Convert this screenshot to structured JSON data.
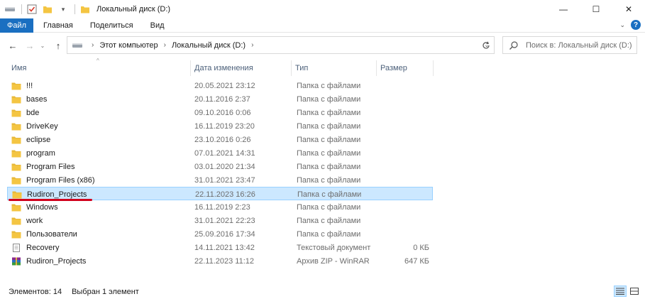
{
  "window": {
    "title": "Локальный диск (D:)",
    "controls": {
      "minimize": "—",
      "maximize": "☐",
      "close": "✕"
    }
  },
  "ribbon": {
    "file_tab": "Файл",
    "tabs": [
      "Главная",
      "Поделиться",
      "Вид"
    ]
  },
  "navigation": {
    "breadcrumb": [
      "Этот компьютер",
      "Локальный диск (D:)"
    ],
    "search_placeholder": "Поиск в: Локальный диск (D:)"
  },
  "columns": {
    "name": "Имя",
    "date": "Дата изменения",
    "type": "Тип",
    "size": "Размер"
  },
  "files": [
    {
      "name": "!!!",
      "date": "20.05.2021 23:12",
      "type": "Папка с файлами",
      "size": "",
      "icon": "folder-icon"
    },
    {
      "name": "bases",
      "date": "20.11.2016 2:37",
      "type": "Папка с файлами",
      "size": "",
      "icon": "folder-icon"
    },
    {
      "name": "bde",
      "date": "09.10.2016 0:06",
      "type": "Папка с файлами",
      "size": "",
      "icon": "folder-icon"
    },
    {
      "name": "DriveKey",
      "date": "16.11.2019 23:20",
      "type": "Папка с файлами",
      "size": "",
      "icon": "folder-icon"
    },
    {
      "name": "eclipse",
      "date": "23.10.2016 0:26",
      "type": "Папка с файлами",
      "size": "",
      "icon": "folder-icon"
    },
    {
      "name": "program",
      "date": "07.01.2021 14:31",
      "type": "Папка с файлами",
      "size": "",
      "icon": "folder-icon"
    },
    {
      "name": "Program Files",
      "date": "03.01.2020 21:34",
      "type": "Папка с файлами",
      "size": "",
      "icon": "folder-icon"
    },
    {
      "name": "Program Files (x86)",
      "date": "31.01.2021 23:47",
      "type": "Папка с файлами",
      "size": "",
      "icon": "folder-icon"
    },
    {
      "name": "Rudiron_Projects",
      "date": "22.11.2023 16:26",
      "type": "Папка с файлами",
      "size": "",
      "icon": "folder-icon",
      "selected": true
    },
    {
      "name": "Windows",
      "date": "16.11.2019 2:23",
      "type": "Папка с файлами",
      "size": "",
      "icon": "folder-icon"
    },
    {
      "name": "work",
      "date": "31.01.2021 22:23",
      "type": "Папка с файлами",
      "size": "",
      "icon": "folder-icon"
    },
    {
      "name": "Пользователи",
      "date": "25.09.2016 17:34",
      "type": "Папка с файлами",
      "size": "",
      "icon": "folder-icon"
    },
    {
      "name": "Recovery",
      "date": "14.11.2021 13:42",
      "type": "Текстовый документ",
      "size": "0 КБ",
      "icon": "text-document-icon"
    },
    {
      "name": "Rudiron_Projects",
      "date": "22.11.2023 11:12",
      "type": "Архив ZIP - WinRAR",
      "size": "647 КБ",
      "icon": "winrar-archive-icon"
    }
  ],
  "status": {
    "items_count": "Элементов: 14",
    "selected": "Выбран 1 элемент"
  },
  "colors": {
    "accent": "#1a6fc1",
    "selection_bg": "#cce8ff",
    "selection_border": "#99d1ff",
    "folder": "#f4c542",
    "annotation_underline": "#d1001c"
  }
}
